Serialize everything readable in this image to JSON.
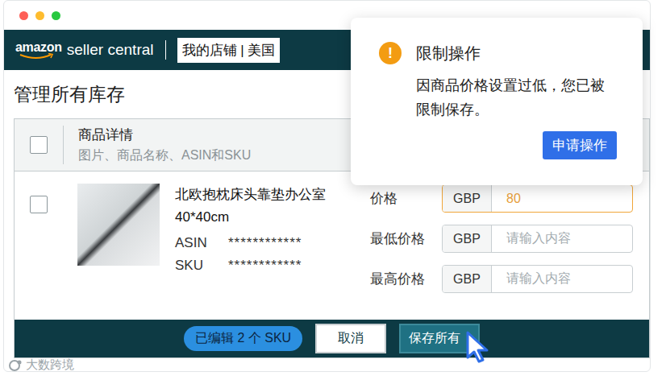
{
  "header": {
    "logo_brand": "amazon",
    "logo_product": "seller central",
    "store": "我的店铺 | 美国"
  },
  "page": {
    "title": "管理所有库存"
  },
  "table": {
    "header": {
      "checked": false,
      "title": "商品详情",
      "subtitle": "图片、商品名称、ASIN和SKU"
    },
    "rows": [
      {
        "checked": false,
        "name": "北欧抱枕床头靠垫办公室 40*40cm",
        "asin_label": "ASIN",
        "asin": "************",
        "sku_label": "SKU",
        "sku": "************",
        "prices": [
          {
            "label": "价格",
            "currency": "GBP",
            "value": "80",
            "placeholder": "",
            "focused": true
          },
          {
            "label": "最低价格",
            "currency": "GBP",
            "value": "",
            "placeholder": "请输入内容",
            "focused": false
          },
          {
            "label": "最高价格",
            "currency": "GBP",
            "value": "",
            "placeholder": "请输入内容",
            "focused": false
          }
        ]
      }
    ]
  },
  "footer": {
    "badge": "已编辑 2 个 SKU",
    "buttons": [
      {
        "label": "取消",
        "kind": "secondary"
      },
      {
        "label": "保存所有",
        "kind": "primary"
      }
    ]
  },
  "dialog": {
    "icon": "!",
    "title": "限制操作",
    "message": "因商品价格设置过低，您已被限制保存。",
    "button": "申请操作"
  },
  "watermark": {
    "text": "大数跨境"
  }
}
